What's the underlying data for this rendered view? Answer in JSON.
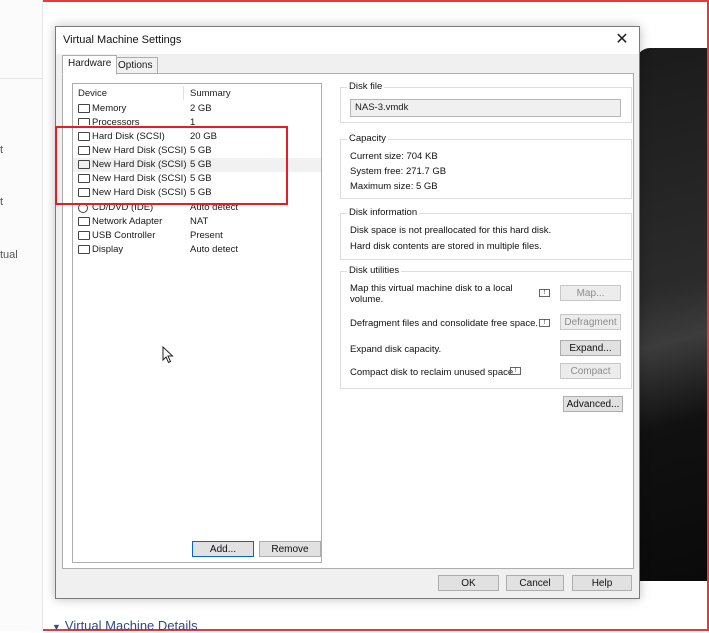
{
  "background": {
    "left_fragments": [
      "t",
      "t",
      "tual"
    ],
    "bottom_link": "Virtual Machine Details"
  },
  "dialog": {
    "title": "Virtual Machine Settings",
    "close_glyph": "✕",
    "tabs": [
      {
        "label": "Hardware",
        "active": true
      },
      {
        "label": "Options",
        "active": false
      }
    ],
    "device_list": {
      "columns": [
        "Device",
        "Summary"
      ],
      "rows": [
        {
          "icon": "memory-icon",
          "device": "Memory",
          "summary": "2 GB"
        },
        {
          "icon": "processor-icon",
          "device": "Processors",
          "summary": "1"
        },
        {
          "icon": "hard-disk-icon",
          "device": "Hard Disk (SCSI)",
          "summary": "20 GB"
        },
        {
          "icon": "hard-disk-icon",
          "device": "New Hard Disk (SCSI)",
          "summary": "5 GB"
        },
        {
          "icon": "hard-disk-icon",
          "device": "New Hard Disk (SCSI)",
          "summary": "5 GB",
          "selected": true
        },
        {
          "icon": "hard-disk-icon",
          "device": "New Hard Disk (SCSI)",
          "summary": "5 GB"
        },
        {
          "icon": "hard-disk-icon",
          "device": "New Hard Disk (SCSI)",
          "summary": "5 GB"
        },
        {
          "icon": "cd-dvd-icon",
          "device": "CD/DVD (IDE)",
          "summary": "Auto detect"
        },
        {
          "icon": "network-adapter-icon",
          "device": "Network Adapter",
          "summary": "NAT"
        },
        {
          "icon": "usb-icon",
          "device": "USB Controller",
          "summary": "Present"
        },
        {
          "icon": "display-icon",
          "device": "Display",
          "summary": "Auto detect"
        }
      ]
    },
    "add_button": "Add...",
    "remove_button": "Remove",
    "disk_file": {
      "title": "Disk file",
      "value": "NAS-3.vmdk"
    },
    "capacity": {
      "title": "Capacity",
      "current": "Current size:  704 KB",
      "free": "System free:  271.7 GB",
      "max": "Maximum size:  5 GB"
    },
    "disk_information": {
      "title": "Disk information",
      "line1": "Disk space is not preallocated for this hard disk.",
      "line2": "Hard disk contents are stored in multiple files."
    },
    "disk_utilities": {
      "title": "Disk utilities",
      "map_text_1": "Map this virtual machine disk to a local",
      "map_text_2": "volume.",
      "map_button": "Map...",
      "defrag_text": "Defragment files and consolidate free space.",
      "defrag_button": "Defragment",
      "expand_text": "Expand disk capacity.",
      "expand_button": "Expand...",
      "compact_text": "Compact disk to reclaim unused space.",
      "compact_button": "Compact"
    },
    "advanced_button": "Advanced...",
    "ok_button": "OK",
    "cancel_button": "Cancel",
    "help_button": "Help"
  },
  "colors": {
    "annotation_red": "#e01f26",
    "default_button_border": "#0a64c8"
  }
}
